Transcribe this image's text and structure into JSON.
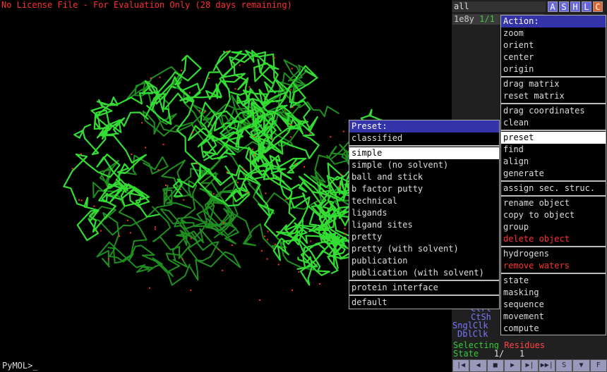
{
  "license_text": "No License File - For Evaluation Only (28 days remaining)",
  "command_prompt": "PyMOL>_",
  "object_panel": {
    "header": "all",
    "buttons": [
      "A",
      "S",
      "H",
      "L",
      "C"
    ],
    "object_name": "1e8y",
    "object_state": "1/1"
  },
  "mouse_info": [
    "Ctrl",
    "CtSh",
    "SnglClk",
    "DblClk"
  ],
  "selecting_label": "Selecting",
  "selecting_value": "Residues",
  "state_label": "State",
  "state_value": "1/   1",
  "controls": [
    "|◀",
    "◀",
    "■",
    "▶",
    "▶|",
    "▶▶|",
    "S",
    "▼",
    "F"
  ],
  "action_menu": {
    "title": "Action:",
    "groups": [
      [
        "zoom",
        "orient",
        "center",
        "origin"
      ],
      [
        "drag matrix",
        "reset matrix"
      ],
      [
        "drag coordinates",
        "clean"
      ],
      [
        "preset",
        "find",
        "align",
        "generate"
      ],
      [
        "assign sec. struc."
      ],
      [
        "rename object",
        "copy to object",
        "group",
        "delete object"
      ],
      [
        "hydrogens",
        "remove waters"
      ],
      [
        "state",
        "masking",
        "sequence",
        "movement",
        "compute"
      ]
    ],
    "selected": "preset",
    "red_items": [
      "delete object",
      "remove waters"
    ]
  },
  "preset_menu": {
    "title": "Preset:",
    "groups": [
      [
        "classified"
      ],
      [
        "simple",
        "simple (no solvent)",
        "ball and stick",
        "b factor putty",
        "technical",
        "ligands",
        "ligand sites",
        "pretty",
        "pretty (with solvent)",
        "publication",
        "publication (with solvent)"
      ],
      [
        "protein interface"
      ],
      [
        "default"
      ]
    ],
    "selected": "simple"
  },
  "colors": {
    "ribbon": "#33dd33",
    "ribbon_dark": "#1f8f1f",
    "water": "#ff3030",
    "menu_title": "#3333aa",
    "button_blue": "#6666dd"
  }
}
